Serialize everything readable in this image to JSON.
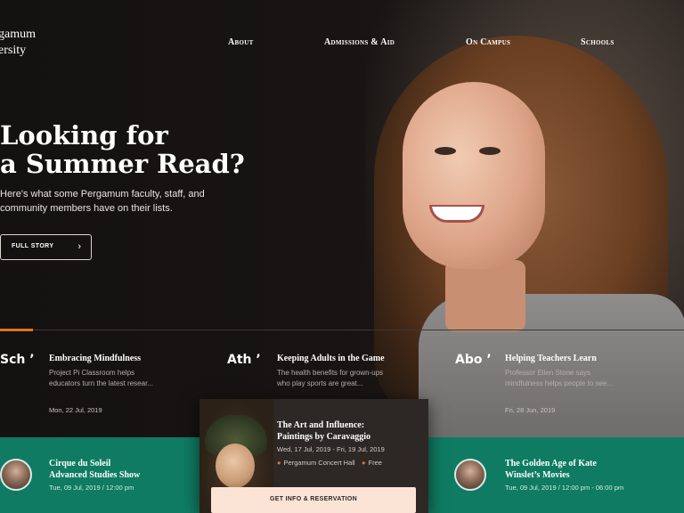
{
  "header": {
    "logo_line1": "gamum",
    "logo_line2": "ersity",
    "nav": [
      "About",
      "Admissions & Aid",
      "On Campus",
      "Schools"
    ]
  },
  "hero": {
    "headline_line1": "Looking for",
    "headline_line2": "a Summer Read?",
    "intro_line1": "Here's what some Pergamum faculty, staff, and",
    "intro_line2": "community members have on their lists.",
    "button_label": "FULL STORY",
    "button_icon": "chevron-right-icon"
  },
  "stories": [
    {
      "tag": "Sch ’",
      "title": "Embracing Mindfulness",
      "desc": "Project Pi Classroom helps educators turn the latest resear...",
      "date": "Mon, 22 Jul, 2019"
    },
    {
      "tag": "Ath ’",
      "title": "Keeping Adults in the Game",
      "desc": "The health benefits for grown-ups who play sports are great...",
      "date": ""
    },
    {
      "tag": "Abo ’",
      "title": "Helping Teachers Learn",
      "desc": "Professor Ellen Stone says mindfulness helps people to see...",
      "date": "Fri, 28 Jun, 2019"
    }
  ],
  "events": [
    {
      "title_line1": "Cirque du Soleil",
      "title_line2": "Advanced Studies Show",
      "date": "Tue, 09 Jul, 2019 / 12:00 pm"
    },
    {
      "title_line1": "The Golden Age of Kate",
      "title_line2": "Winslet’s Movies",
      "date": "Tue, 09 Jul, 2019 / 12:00 pm - 06:00 pm"
    }
  ],
  "feature": {
    "title_line1": "The Art and Influence:",
    "title_line2": "Paintings by Caravaggio",
    "date": "Wed, 17 Jul, 2019 - Fri, 19 Jul, 2019",
    "location": "Pergamum Concert Hall",
    "price": "Free",
    "button_label": "GET INFO & RESERVATION"
  },
  "colors": {
    "accent": "#e26f26",
    "strip": "#0f7b62",
    "background": "#131110"
  }
}
